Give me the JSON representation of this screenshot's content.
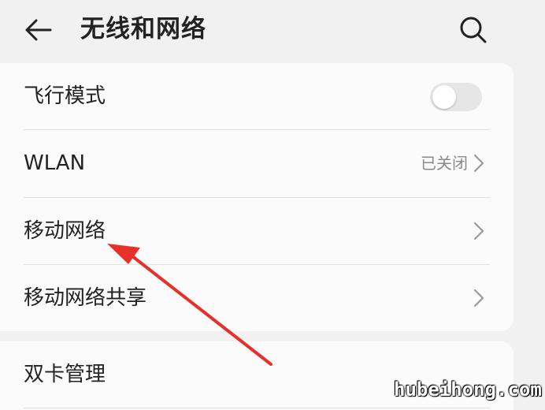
{
  "header": {
    "title": "无线和网络",
    "back_icon": "back-arrow-icon",
    "search_icon": "search-icon"
  },
  "settings": {
    "airplane_mode": {
      "label": "飞行模式",
      "enabled": false
    },
    "wlan": {
      "label": "WLAN",
      "status": "已关闭"
    },
    "mobile_network": {
      "label": "移动网络"
    },
    "tethering": {
      "label": "移动网络共享"
    },
    "dual_sim": {
      "label": "双卡管理"
    }
  },
  "annotation": {
    "color": "#e8302a"
  },
  "watermark": "hubeihong.com",
  "colors": {
    "background": "#f1f1f1",
    "card": "#fbfbfb",
    "toggle_off": "#e6e6e6",
    "muted_text": "#8a8a8a"
  }
}
